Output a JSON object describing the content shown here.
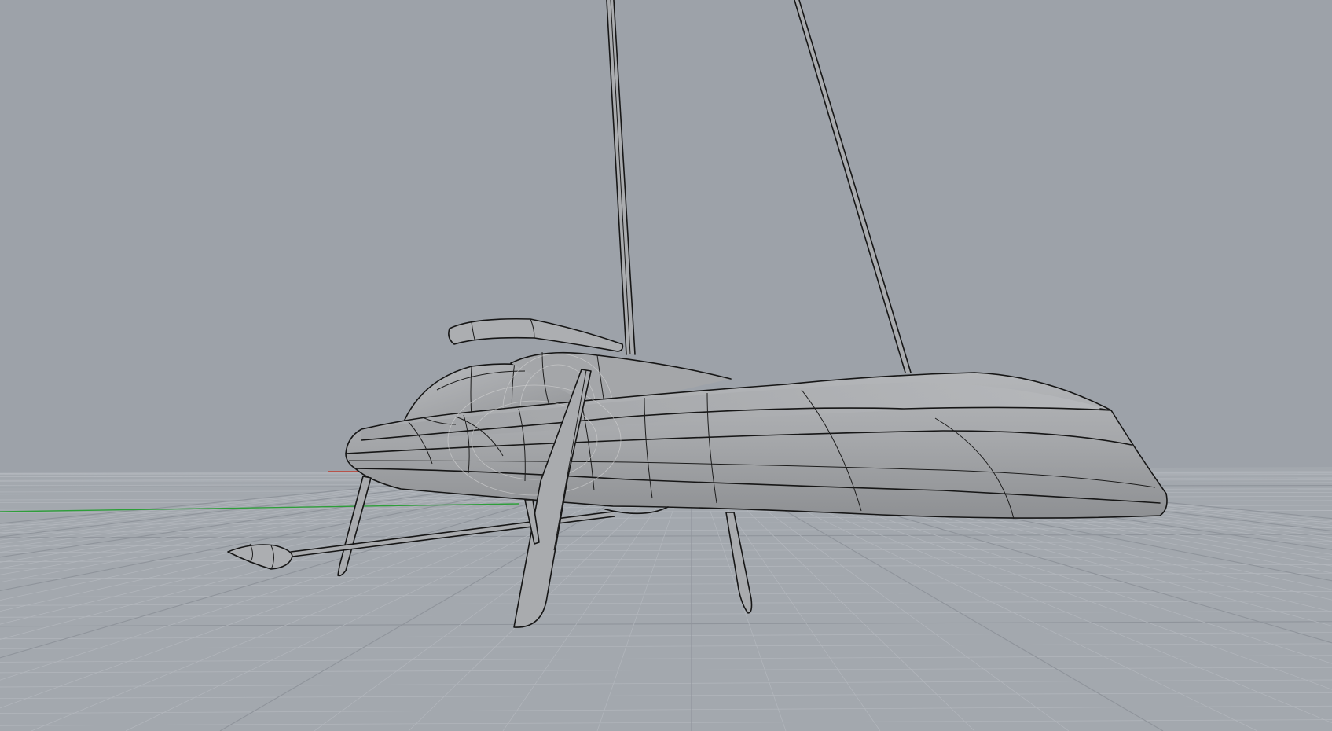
{
  "viewport": {
    "background_color": "#9da2a9",
    "grid_color": "#b3b7bd",
    "grid_major_color": "#8f949b",
    "x_axis_color": "#c0392b",
    "y_axis_color": "#2e9e3a",
    "shaded_surface_color": "#a8aaad",
    "edge_color": "#161616"
  },
  "model": {
    "parts": [
      "hull-icon",
      "mast-icon",
      "forestay-icon",
      "boom-icon",
      "cockpit-icon",
      "front-foil-icon",
      "rear-foil-icon",
      "rudder-icon",
      "bowsprit-icon"
    ]
  }
}
